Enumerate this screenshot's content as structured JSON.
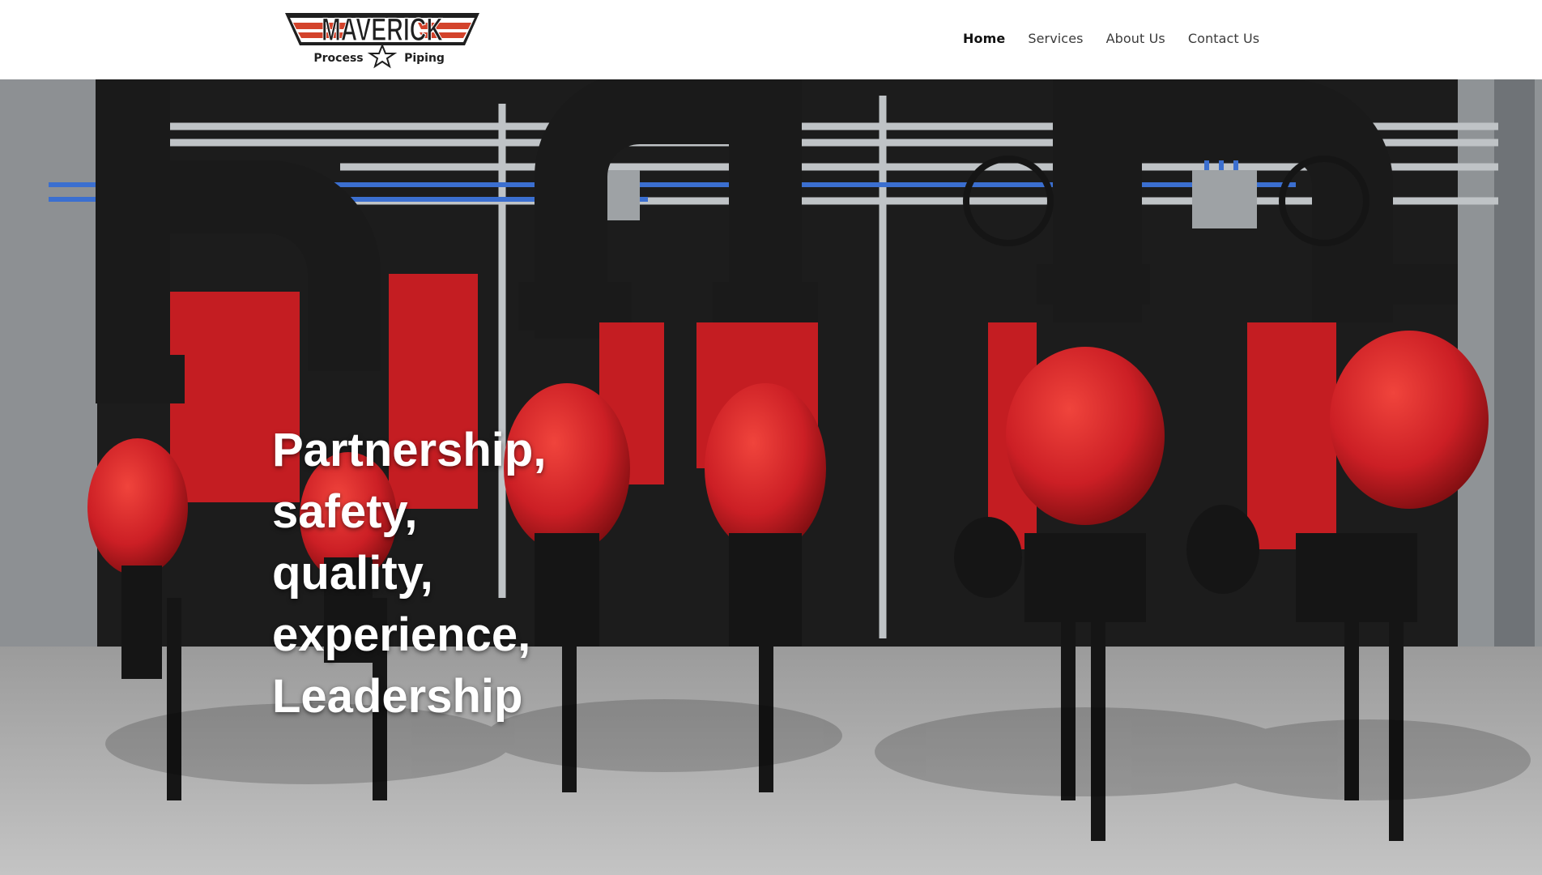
{
  "logo": {
    "wordmark": "MAVERICK",
    "tagline_left": "Process",
    "tagline_right": "Piping",
    "colors": {
      "primary": "#1f1f1f",
      "accent": "#d3432b"
    }
  },
  "nav": {
    "items": [
      {
        "label": "Home",
        "active": true
      },
      {
        "label": "Services",
        "active": false
      },
      {
        "label": "About Us",
        "active": false
      },
      {
        "label": "Contact Us",
        "active": false
      }
    ]
  },
  "hero": {
    "headline_lines": [
      "Partnership,",
      "safety,",
      "quality,",
      "experience,",
      "Leadership"
    ],
    "colors": {
      "pump_red": "#cc1f25",
      "pipe_black": "#1a1a1a",
      "floor": "#a9a9a9"
    }
  }
}
